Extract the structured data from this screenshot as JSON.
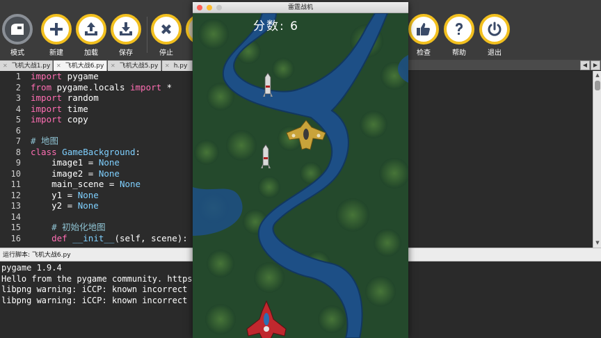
{
  "toolbar": {
    "left_buttons": [
      {
        "label": "模式",
        "icon": "mode-icon"
      },
      {
        "label": "新建",
        "icon": "plus-icon"
      },
      {
        "label": "加载",
        "icon": "upload-icon"
      },
      {
        "label": "保存",
        "icon": "download-icon"
      },
      {
        "label": "停止",
        "icon": "close-icon"
      }
    ],
    "right_buttons": [
      {
        "label": "检查",
        "icon": "thumbs-up-icon"
      },
      {
        "label": "帮助",
        "icon": "question-icon"
      },
      {
        "label": "退出",
        "icon": "power-icon"
      }
    ],
    "accent_color": "#f2c01f"
  },
  "tabs": [
    {
      "label": "飞机大战1.py"
    },
    {
      "label": "飞机大战6.py",
      "active": true
    },
    {
      "label": "飞机大战5.py"
    },
    {
      "label": "h.py"
    }
  ],
  "editor": {
    "line_numbers": [
      "1",
      "2",
      "3",
      "4",
      "5",
      "6",
      "7",
      "8",
      "9",
      "10",
      "11",
      "12",
      "13",
      "14",
      "15",
      "16"
    ],
    "lines": [
      [
        {
          "t": "import",
          "c": "kw"
        },
        {
          "t": " pygame"
        }
      ],
      [
        {
          "t": "from",
          "c": "kw"
        },
        {
          "t": " pygame.locals "
        },
        {
          "t": "import",
          "c": "kw"
        },
        {
          "t": " *"
        }
      ],
      [
        {
          "t": "import",
          "c": "kw"
        },
        {
          "t": " random"
        }
      ],
      [
        {
          "t": "import",
          "c": "kw"
        },
        {
          "t": " time"
        }
      ],
      [
        {
          "t": "import",
          "c": "kw"
        },
        {
          "t": " copy"
        }
      ],
      [],
      [
        {
          "t": "# 地图",
          "c": "cm"
        }
      ],
      [
        {
          "t": "class",
          "c": "kw"
        },
        {
          "t": " "
        },
        {
          "t": "GameBackground",
          "c": "cls"
        },
        {
          "t": ":"
        }
      ],
      [
        {
          "t": "    image1 = "
        },
        {
          "t": "None",
          "c": "cn"
        }
      ],
      [
        {
          "t": "    image2 = "
        },
        {
          "t": "None",
          "c": "cn"
        }
      ],
      [
        {
          "t": "    main_scene = "
        },
        {
          "t": "None",
          "c": "cn"
        }
      ],
      [
        {
          "t": "    y1 = "
        },
        {
          "t": "None",
          "c": "cn"
        }
      ],
      [
        {
          "t": "    y2 = "
        },
        {
          "t": "None",
          "c": "cn"
        }
      ],
      [],
      [
        {
          "t": "    # 初始化地图",
          "c": "cm"
        }
      ],
      [
        {
          "t": "    "
        },
        {
          "t": "def",
          "c": "kw"
        },
        {
          "t": " "
        },
        {
          "t": "__init__",
          "c": "cls"
        },
        {
          "t": "(self, scene):"
        }
      ]
    ]
  },
  "console": {
    "header": "运行脚本: 飞机大战6.py",
    "lines": [
      "pygame 1.9.4",
      "Hello from the pygame community. https://ww",
      "libpng warning: iCCP: known incorrect sRGB",
      "libpng warning: iCCP: known incorrect sRGB"
    ]
  },
  "game_window": {
    "title": "雷霆战机",
    "score_text": "分数: 6"
  }
}
